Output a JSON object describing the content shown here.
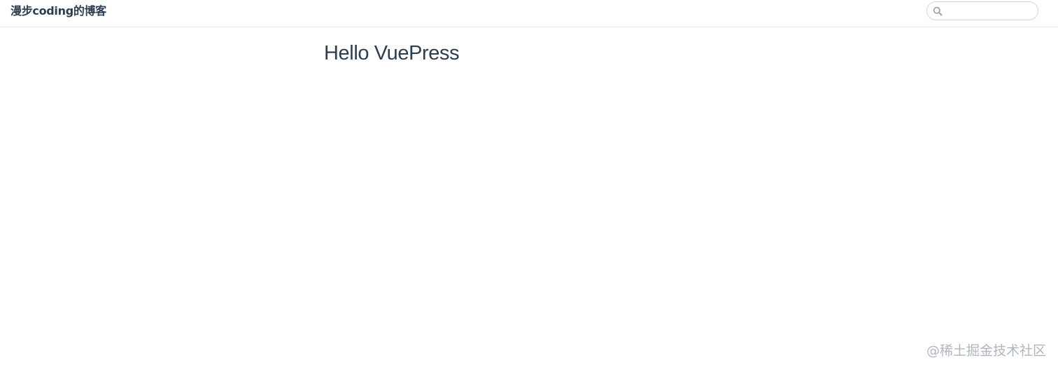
{
  "navbar": {
    "site_name": "漫步coding的博客",
    "search": {
      "icon": "search-icon",
      "value": "",
      "placeholder": ""
    }
  },
  "content": {
    "title": "Hello VuePress"
  },
  "watermark": {
    "text": "@稀土掘金技术社区"
  }
}
